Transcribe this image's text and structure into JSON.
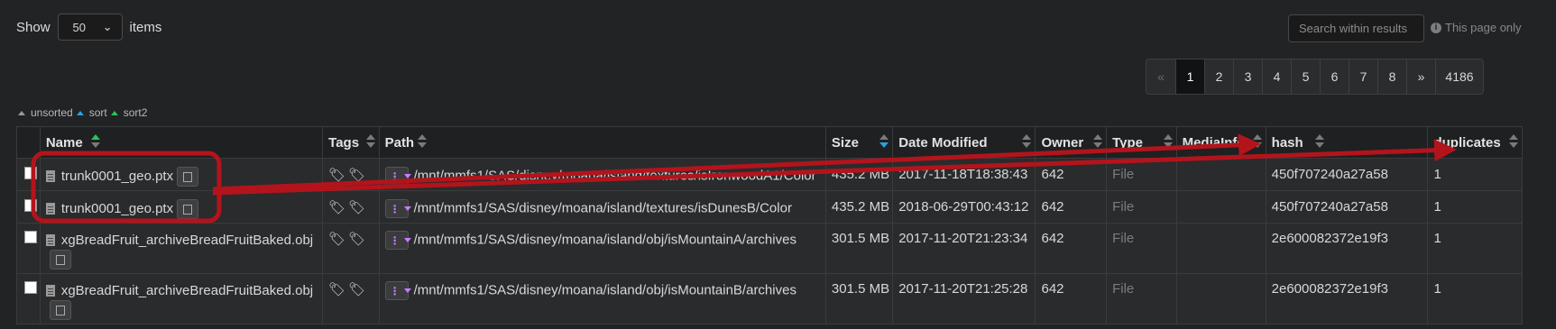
{
  "controls": {
    "show_label": "Show",
    "per_page": "50",
    "items_label": "items",
    "search_placeholder": "Search within results",
    "page_only": "This page only"
  },
  "pagination": [
    "«",
    "1",
    "2",
    "3",
    "4",
    "5",
    "6",
    "7",
    "8",
    "»",
    "4186"
  ],
  "sort_info": [
    "unsorted",
    "sort",
    "sort2"
  ],
  "columns": [
    "Name",
    "Tags",
    "Path",
    "Size",
    "Date Modified",
    "Owner",
    "Type",
    "MediaInfo",
    "hash",
    "duplicates"
  ],
  "rows": [
    {
      "name": "trunk0001_geo.ptx",
      "tags": "🏷🏷",
      "path": "/mnt/mmfs1/SAS/disney/moana/island/textures/isIronwoodA1/Color",
      "size": "435.2 MB",
      "modified": "2017-11-18T18:38:43",
      "owner": "642",
      "type": "File",
      "mediainfo": "",
      "hash": "450f707240a27a58",
      "duplicates": "1"
    },
    {
      "name": "trunk0001_geo.ptx",
      "tags": "🏷🏷",
      "path": "/mnt/mmfs1/SAS/disney/moana/island/textures/isDunesB/Color",
      "size": "435.2 MB",
      "modified": "2018-06-29T00:43:12",
      "owner": "642",
      "type": "File",
      "mediainfo": "",
      "hash": "450f707240a27a58",
      "duplicates": "1"
    },
    {
      "name": "xgBreadFruit_archiveBreadFruitBaked.obj",
      "tags": "🏷🏷",
      "path": "/mnt/mmfs1/SAS/disney/moana/island/obj/isMountainA/archives",
      "size": "301.5 MB",
      "modified": "2017-11-20T21:23:34",
      "owner": "642",
      "type": "File",
      "mediainfo": "",
      "hash": "2e600082372e19f3",
      "duplicates": "1"
    },
    {
      "name": "xgBreadFruit_archiveBreadFruitBaked.obj",
      "tags": "🏷🏷",
      "path": "/mnt/mmfs1/SAS/disney/moana/island/obj/isMountainB/archives",
      "size": "301.5 MB",
      "modified": "2017-11-20T21:25:28",
      "owner": "642",
      "type": "File",
      "mediainfo": "",
      "hash": "2e600082372e19f3",
      "duplicates": "1"
    }
  ],
  "colors": {
    "annotation": "#b3141c",
    "sort_active": "#2ac35a",
    "sort_desc": "#29a3e0",
    "dropdown_accent": "#c77dff"
  }
}
